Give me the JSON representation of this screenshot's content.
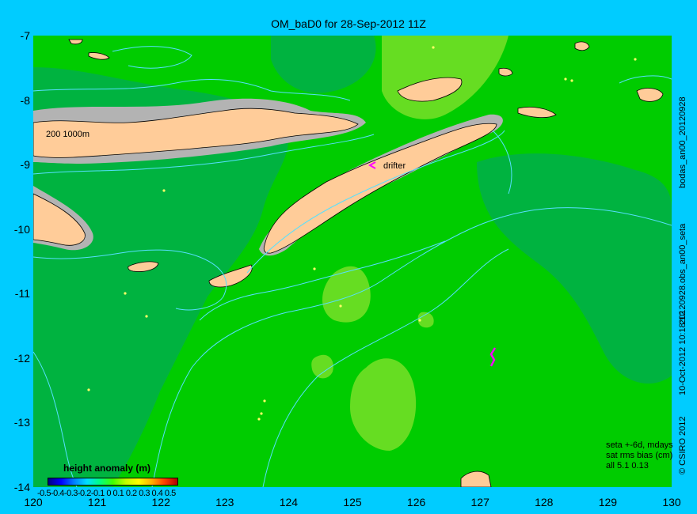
{
  "title": "OM_baD0 for 28-Sep-2012 11Z",
  "axes": {
    "y_ticks": [
      "-7",
      "-8",
      "-9",
      "-10",
      "-11",
      "-12",
      "-13",
      "-14"
    ],
    "x_ticks": [
      "120",
      "121",
      "122",
      "123",
      "124",
      "125",
      "126",
      "127",
      "128",
      "129",
      "130"
    ],
    "lon_range": [
      120,
      130
    ],
    "lat_range": [
      -14,
      -7
    ]
  },
  "map_labels": {
    "isobaths": "200  1000m",
    "drifter": "drifter"
  },
  "legend": {
    "title": "height anomaly  (m)",
    "ticks": "-0.5-0.4-0.3-0.2-0.1 0 0.1 0.2 0.3 0.4 0.5",
    "range": [
      -0.5,
      0.5
    ]
  },
  "stats": {
    "line1": "seta +-6d, mdays",
    "line2": "sat rms bias (cm)",
    "line3": "all 5.1 0.13"
  },
  "side_labels": {
    "label1": "bodas_an00_20120928",
    "label2": "20120928.obs_an00_seta",
    "label3": "10-Oct-2012 10:18:12",
    "label4": "© CSIRO 2012"
  },
  "colors": {
    "background": "#00ccff",
    "ocean_main": "#00cc00",
    "ocean_dark": "#00b340",
    "ocean_light": "#66dd22",
    "land": "#ffcc99",
    "shelf": "#b3b3b3",
    "contour": "#55e0ff",
    "drifter": "#ff00ff",
    "points": "#ffff66"
  }
}
